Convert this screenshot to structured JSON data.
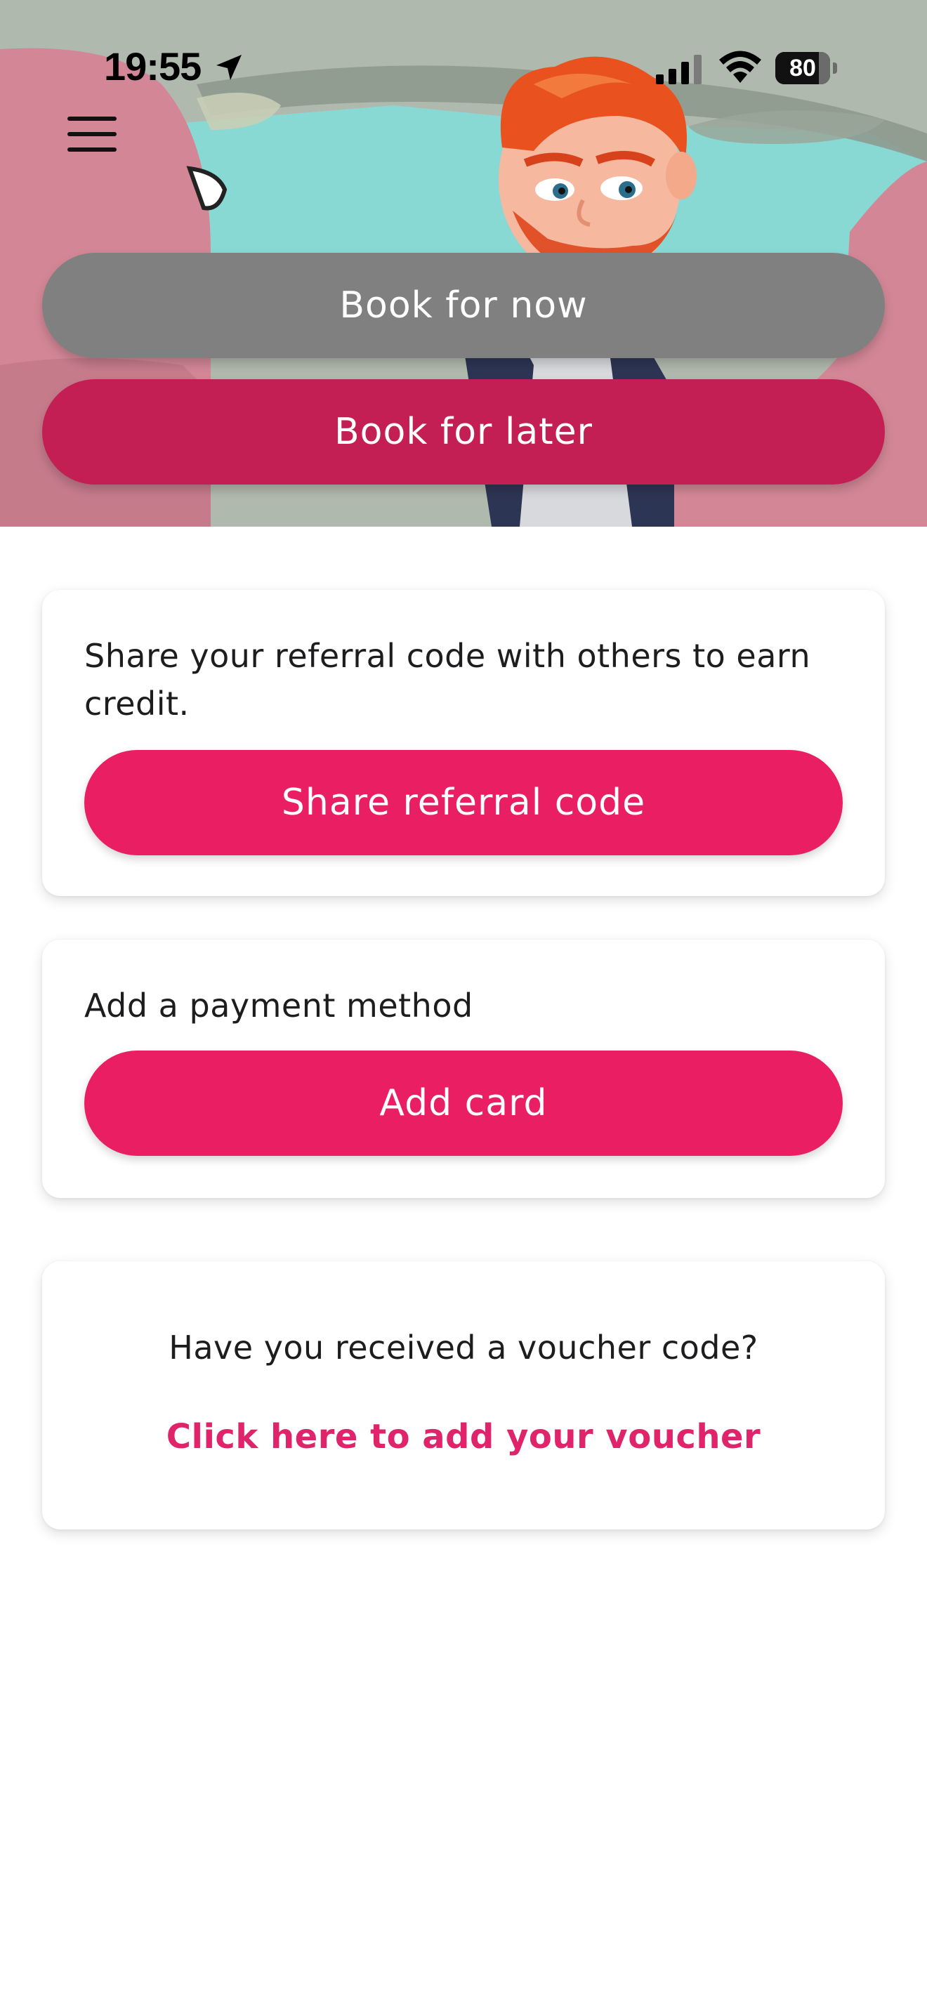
{
  "status_bar": {
    "time": "19:55",
    "battery_level": "80",
    "battery_fraction": 0.8
  },
  "header": {
    "menu_icon": "hamburger-menu-icon",
    "hero_illustration": "chauffeur-in-car-illustration"
  },
  "booking": {
    "book_now_label": "Book for now",
    "book_later_label": "Book for later"
  },
  "referral": {
    "description": "Share your referral code with others to earn credit.",
    "button_label": "Share referral code"
  },
  "payment": {
    "description": "Add a payment method",
    "button_label": "Add card"
  },
  "voucher": {
    "question": "Have you received a voucher code?",
    "link_label": "Click here to add your voucher"
  },
  "colors": {
    "brand_pink": "#e91e63",
    "brand_dark_pink": "#c41f55",
    "grey_button": "#808080",
    "link_pink": "#e0246b"
  }
}
